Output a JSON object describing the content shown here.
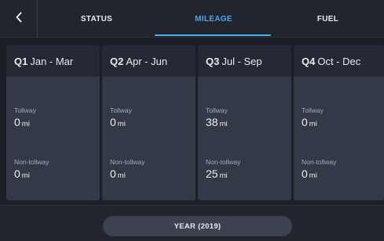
{
  "tabs": {
    "status": "STATUS",
    "mileage": "MILEAGE",
    "fuel": "FUEL"
  },
  "accent_color": "#4aa8ea",
  "quarters": [
    {
      "q": "Q1",
      "range": "Jan - Mar",
      "tollway_label": "Tollway",
      "tollway_value": "0",
      "tollway_unit": "mi",
      "nontollway_label": "Non-tollway",
      "nontollway_value": "0",
      "nontollway_unit": "mi"
    },
    {
      "q": "Q2",
      "range": "Apr - Jun",
      "tollway_label": "Tollway",
      "tollway_value": "0",
      "tollway_unit": "mi",
      "nontollway_label": "Non-tollway",
      "nontollway_value": "0",
      "nontollway_unit": "mi"
    },
    {
      "q": "Q3",
      "range": "Jul - Sep",
      "tollway_label": "Tollway",
      "tollway_value": "38",
      "tollway_unit": "mi",
      "nontollway_label": "Non-tollway",
      "nontollway_value": "25",
      "nontollway_unit": "mi"
    },
    {
      "q": "Q4",
      "range": "Oct - Dec",
      "tollway_label": "Tollway",
      "tollway_value": "0",
      "tollway_unit": "mi",
      "nontollway_label": "Non-tollway",
      "nontollway_value": "0",
      "nontollway_unit": "mi"
    }
  ],
  "year_button": "YEAR (2019)"
}
